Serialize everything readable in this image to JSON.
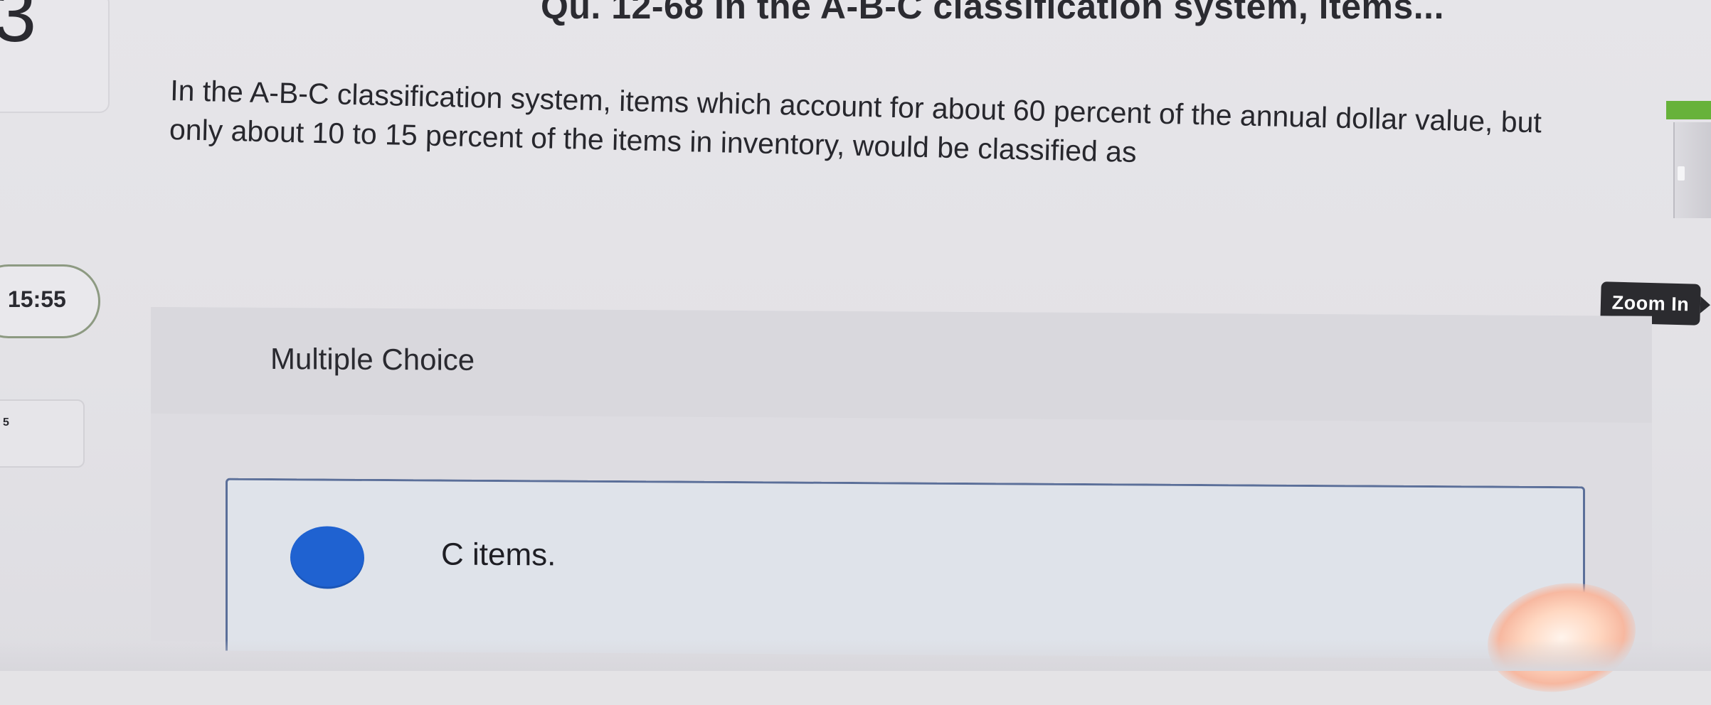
{
  "sidebar": {
    "question_number": "3",
    "timer": "15:55",
    "side_mark": "5"
  },
  "question": {
    "header": "Qu. 12-68 In the A-B-C classification system, items...",
    "prompt": "In the A-B-C classification system, items which account for about 60 percent of the annual dollar value, but only about 10 to 15 percent of the items in inventory, would be classified as"
  },
  "controls": {
    "zoom_label": "Zoom In"
  },
  "answer_area": {
    "type_label": "Multiple Choice",
    "options": [
      {
        "label": "C items.",
        "selected": true
      }
    ]
  },
  "colors": {
    "accent": "#1f62d1",
    "option_border": "#5b6f99",
    "timer_border": "#8d9a82",
    "edge_green": "#67b23a"
  }
}
